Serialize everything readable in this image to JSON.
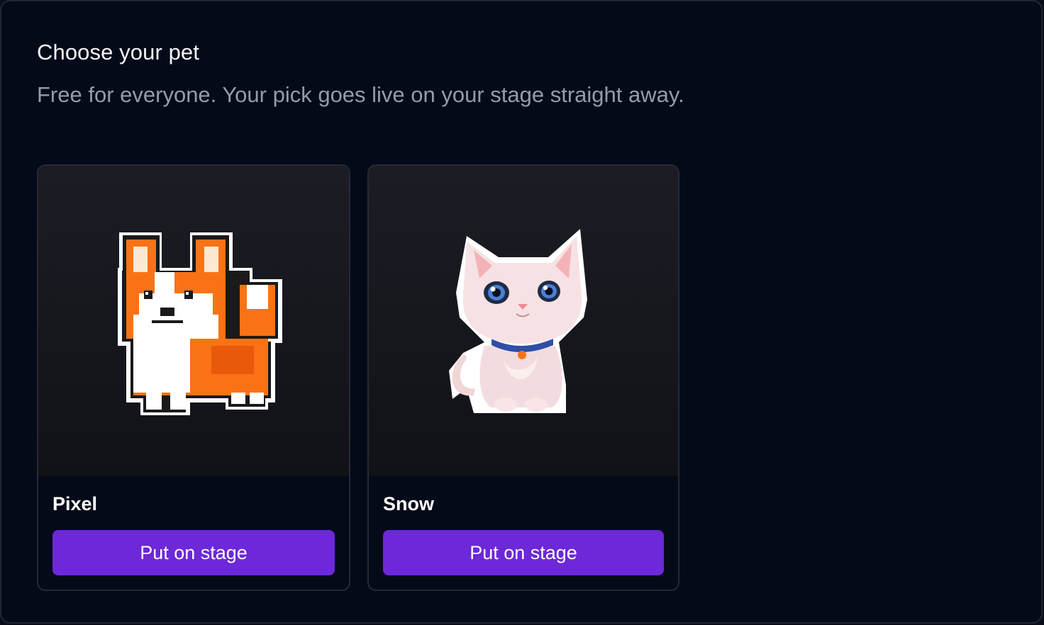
{
  "header": {
    "title": "Choose your pet",
    "subtitle": "Free for everyone. Your pick goes live on your stage straight away."
  },
  "pets": [
    {
      "name": "Pixel",
      "image": "corgi-pixel-art",
      "button_label": "Put on stage"
    },
    {
      "name": "Snow",
      "image": "white-kitten",
      "button_label": "Put on stage"
    }
  ],
  "colors": {
    "background": "#050a18",
    "card_border": "#262a36",
    "accent": "#6d28d9",
    "subtitle": "#969bab"
  }
}
